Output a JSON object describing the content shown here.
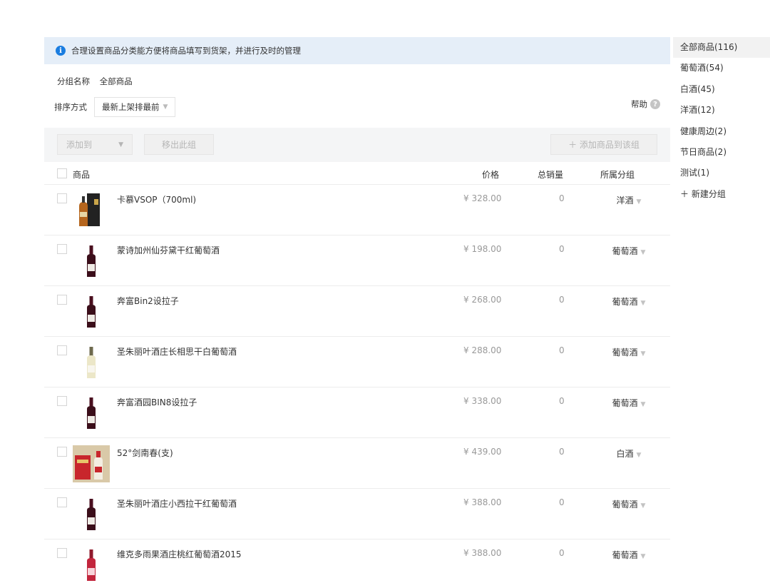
{
  "notice": {
    "text": "合理设置商品分类能方便将商品填写到货架，并进行及时的管理"
  },
  "group": {
    "label": "分组名称",
    "value": "全部商品"
  },
  "sort": {
    "label": "排序方式",
    "value": "最新上架排最前"
  },
  "help": {
    "label": "帮助"
  },
  "toolbar": {
    "add_to": "添加到",
    "remove": "移出此组",
    "add_goods": "＋ 添加商品到该组"
  },
  "table": {
    "headers": {
      "name": "商品",
      "price": "价格",
      "sales": "总销量",
      "group": "所属分组"
    },
    "rows": [
      {
        "name": "卡慕VSOP（700ml)",
        "price": "¥ 328.00",
        "sales": "0",
        "group": "洋酒",
        "thumb": "cognac"
      },
      {
        "name": "蒙诗加州仙芬黛干红葡萄酒",
        "price": "¥ 198.00",
        "sales": "0",
        "group": "葡萄酒",
        "thumb": "red"
      },
      {
        "name": "奔富Bin2设拉子",
        "price": "¥ 268.00",
        "sales": "0",
        "group": "葡萄酒",
        "thumb": "red"
      },
      {
        "name": "圣朱丽叶酒庄长相思干白葡萄酒",
        "price": "¥ 288.00",
        "sales": "0",
        "group": "葡萄酒",
        "thumb": "white"
      },
      {
        "name": "奔富酒园BIN8设拉子",
        "price": "¥ 338.00",
        "sales": "0",
        "group": "葡萄酒",
        "thumb": "red"
      },
      {
        "name": "52°剑南春(支)",
        "price": "¥ 439.00",
        "sales": "0",
        "group": "白酒",
        "thumb": "baijiu"
      },
      {
        "name": "圣朱丽叶酒庄小西拉干红葡萄酒",
        "price": "¥ 388.00",
        "sales": "0",
        "group": "葡萄酒",
        "thumb": "red"
      },
      {
        "name": "维克多雨果酒庄桃红葡萄酒2015",
        "price": "¥ 388.00",
        "sales": "0",
        "group": "葡萄酒",
        "thumb": "rose"
      }
    ]
  },
  "sidebar": {
    "items": [
      {
        "label": "全部商品(116)",
        "active": true
      },
      {
        "label": "葡萄酒(54)"
      },
      {
        "label": "白酒(45)"
      },
      {
        "label": "洋酒(12)"
      },
      {
        "label": "健康周边(2)"
      },
      {
        "label": "节日商品(2)"
      },
      {
        "label": "测试(1)"
      },
      {
        "label": "＋ 新建分组"
      }
    ]
  },
  "colors": {
    "accent": "#1a7de0",
    "notice_bg": "#e5eef8",
    "toolbar_bg": "#f4f5f6",
    "active_bg": "#f2f2f2"
  }
}
